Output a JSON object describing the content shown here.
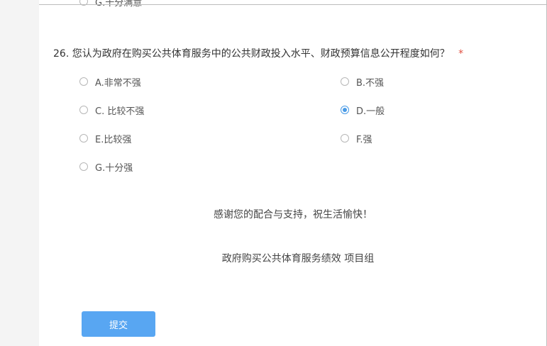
{
  "previous_question": {
    "last_option_label": "G.十分满意"
  },
  "question": {
    "number": "26.",
    "text": "您认为政府在购买公共体育服务中的公共财政投入水平、财政预算信息公开程度如何？",
    "required_mark": "*",
    "options": [
      {
        "label": "A.非常不强",
        "selected": false
      },
      {
        "label": "B.不强",
        "selected": false
      },
      {
        "label": "C. 比较不强",
        "selected": false
      },
      {
        "label": "D.一般",
        "selected": true
      },
      {
        "label": "E.比较强",
        "selected": false
      },
      {
        "label": "F.强",
        "selected": false
      },
      {
        "label": "G.十分强",
        "selected": false
      }
    ]
  },
  "closing": {
    "thanks": "感谢您的配合与支持，祝生活愉快！",
    "team": "政府购买公共体育服务绩效 项目组"
  },
  "submit": {
    "label": "提交"
  },
  "colors": {
    "accent": "#58a6f2",
    "radio_checked": "#4a9be6",
    "required": "#e04f40"
  }
}
